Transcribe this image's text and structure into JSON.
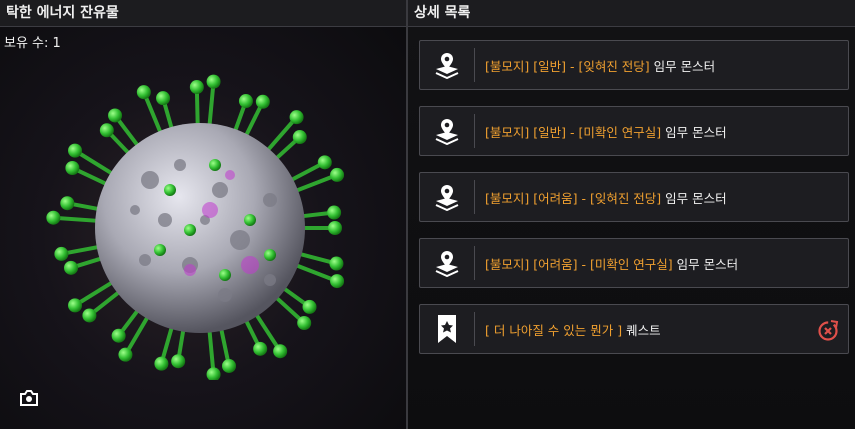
{
  "left_panel": {
    "title": "탁한 에너지 잔유물",
    "owned_label": "보유 수:",
    "owned_count": "1"
  },
  "right_panel": {
    "title": "상세 목록",
    "items": [
      {
        "icon": "map-pin-icon",
        "highlight": "[불모지] [일반] - [잊혀진 전당]",
        "suffix": "임무 몬스터"
      },
      {
        "icon": "map-pin-icon",
        "highlight": "[불모지] [일반] - [미확인 연구실]",
        "suffix": "임무 몬스터"
      },
      {
        "icon": "map-pin-icon",
        "highlight": "[불모지] [어려움] - [잊혀진 전당]",
        "suffix": "임무 몬스터"
      },
      {
        "icon": "map-pin-icon",
        "highlight": "[불모지] [어려움] - [미확인 연구실]",
        "suffix": "임무 몬스터"
      },
      {
        "icon": "quest-bookmark-icon",
        "highlight": "[ 더 나아질 수 있는 뭔가 ]",
        "suffix": "퀘스트",
        "action_icon": "navigate-target-icon"
      }
    ]
  },
  "colors": {
    "accent_orange": "#f0a030",
    "action_red": "#e0504a",
    "virus_body": "#b8b8c0",
    "virus_spike": "#3cc43c"
  }
}
